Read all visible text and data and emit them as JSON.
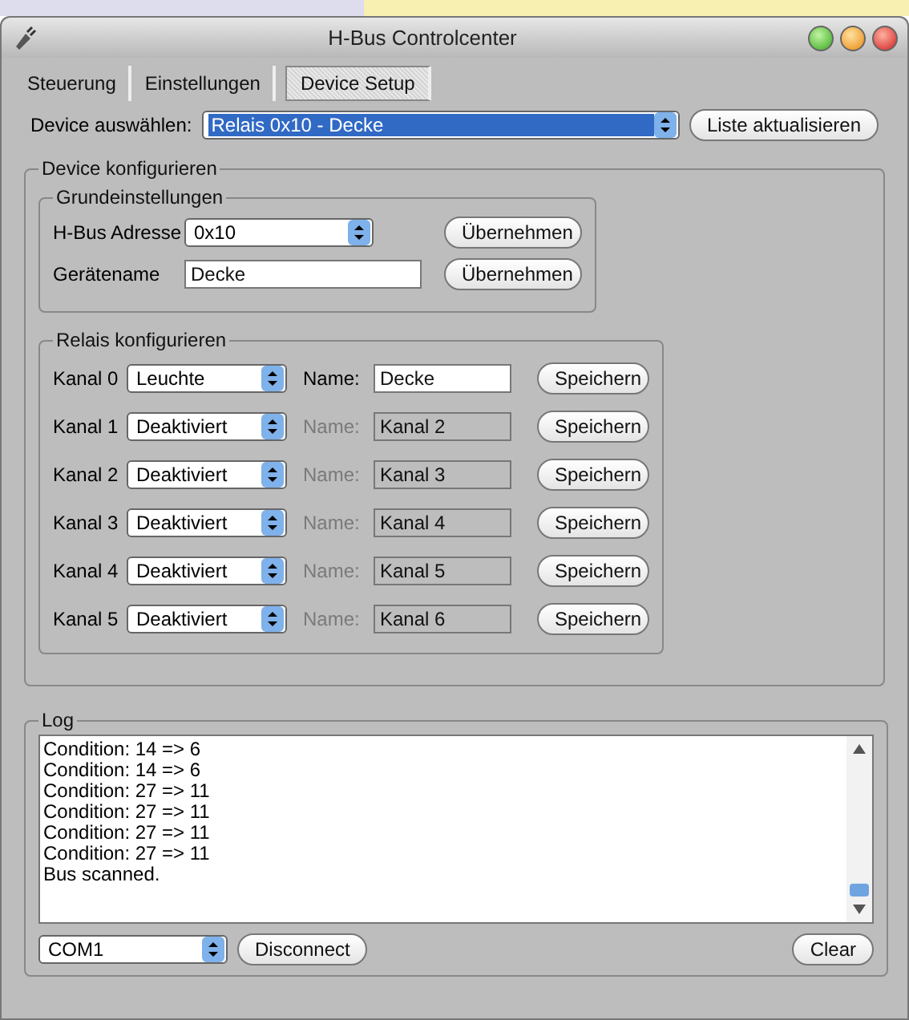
{
  "window": {
    "title": "H-Bus Controlcenter"
  },
  "tabs": [
    {
      "label": "Steuerung",
      "selected": false
    },
    {
      "label": "Einstellungen",
      "selected": false
    },
    {
      "label": "Device Setup",
      "selected": true
    }
  ],
  "device_select": {
    "label": "Device auswählen:",
    "value": "Relais 0x10  -  Decke",
    "refresh_button": "Liste aktualisieren"
  },
  "device_config": {
    "title": "Device konfigurieren",
    "basic": {
      "title": "Grundeinstellungen",
      "address_label": "H-Bus Adresse",
      "address_value": "0x10",
      "address_button": "Übernehmen",
      "name_label": "Gerätename",
      "name_value": "Decke",
      "name_button": "Übernehmen"
    },
    "relays": {
      "title": "Relais konfigurieren",
      "channels": [
        {
          "label": "Kanal 0",
          "type": "Leuchte",
          "name_label": "Name:",
          "name": "Decke",
          "disabled": false,
          "button": "Speichern"
        },
        {
          "label": "Kanal 1",
          "type": "Deaktiviert",
          "name_label": "Name:",
          "name": "Kanal 2",
          "disabled": true,
          "button": "Speichern"
        },
        {
          "label": "Kanal 2",
          "type": "Deaktiviert",
          "name_label": "Name:",
          "name": "Kanal 3",
          "disabled": true,
          "button": "Speichern"
        },
        {
          "label": "Kanal 3",
          "type": "Deaktiviert",
          "name_label": "Name:",
          "name": "Kanal 4",
          "disabled": true,
          "button": "Speichern"
        },
        {
          "label": "Kanal 4",
          "type": "Deaktiviert",
          "name_label": "Name:",
          "name": "Kanal 5",
          "disabled": true,
          "button": "Speichern"
        },
        {
          "label": "Kanal 5",
          "type": "Deaktiviert",
          "name_label": "Name:",
          "name": "Kanal 6",
          "disabled": true,
          "button": "Speichern"
        }
      ]
    }
  },
  "log": {
    "title": "Log",
    "lines": [
      "Condition: 14 => 6",
      "Condition: 14 => 6",
      "Condition: 27 => 11",
      "Condition: 27 => 11",
      "Condition: 27 => 11",
      "Condition: 27 => 11",
      "Bus scanned."
    ],
    "port": "COM1",
    "connect_button": "Disconnect",
    "clear_button": "Clear"
  }
}
